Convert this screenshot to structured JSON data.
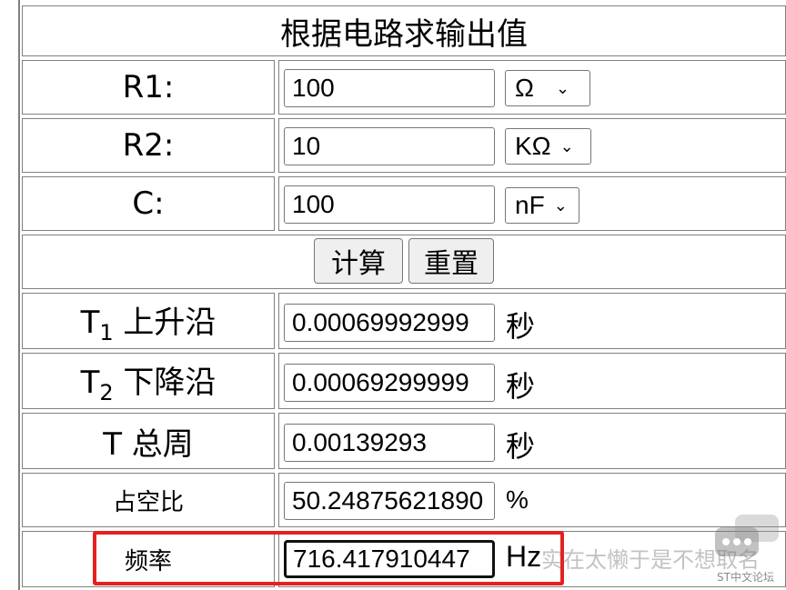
{
  "title": "根据电路求输出值",
  "inputs": {
    "r1": {
      "label": "R1:",
      "value": "100",
      "unit": "Ω"
    },
    "r2": {
      "label": "R2:",
      "value": "10",
      "unit": "KΩ"
    },
    "c": {
      "label": "C:",
      "value": "100",
      "unit": "nF"
    }
  },
  "buttons": {
    "calculate": "计算",
    "reset": "重置"
  },
  "outputs": {
    "t1": {
      "label_main": "T",
      "label_sub": "1",
      "label_rest": " 上升沿",
      "value": "0.00069992999",
      "unit": "秒"
    },
    "t2": {
      "label_main": "T",
      "label_sub": "2",
      "label_rest": " 下降沿",
      "value": "0.00069299999",
      "unit": "秒"
    },
    "t": {
      "label": "T 总周",
      "value": "0.00139293",
      "unit": "秒"
    },
    "duty": {
      "label": "占空比",
      "value": "50.24875621890",
      "unit": "%"
    },
    "freq": {
      "label": "频率",
      "value": "716.417910447",
      "unit": "Hz"
    }
  },
  "watermark": {
    "text": "实在太懒于是不想取名",
    "site": "ST中文论坛"
  },
  "colors": {
    "highlight": "#e52020",
    "border": "#808080"
  }
}
